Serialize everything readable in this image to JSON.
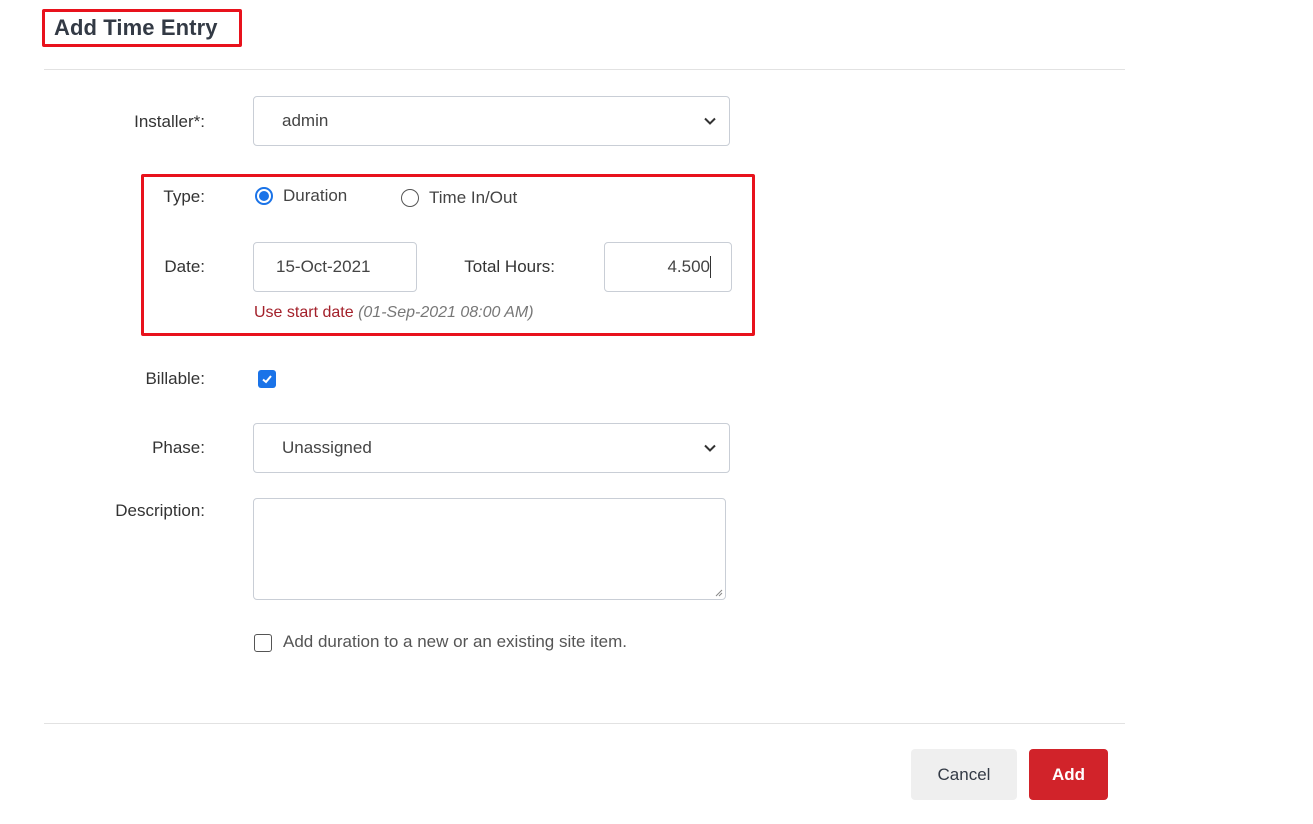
{
  "dialog": {
    "title": "Add Time Entry"
  },
  "form": {
    "installer": {
      "label": "Installer*:",
      "value": "admin"
    },
    "type": {
      "label": "Type:",
      "options": [
        {
          "label": "Duration",
          "checked": true
        },
        {
          "label": "Time In/Out",
          "checked": false
        }
      ]
    },
    "date": {
      "label": "Date:",
      "value": "15-Oct-2021"
    },
    "total_hours": {
      "label": "Total Hours:",
      "value": "4.500"
    },
    "start_date_hint": {
      "link": "Use start date",
      "date": "(01-Sep-2021 08:00 AM)"
    },
    "billable": {
      "label": "Billable:",
      "checked": true
    },
    "phase": {
      "label": "Phase:",
      "value": "Unassigned"
    },
    "description": {
      "label": "Description:",
      "value": ""
    },
    "add_duration": {
      "label": "Add duration to a new or an existing site item.",
      "checked": false
    }
  },
  "actions": {
    "cancel_label": "Cancel",
    "add_label": "Add"
  },
  "colors": {
    "accent_blue": "#1a73e8",
    "primary_red": "#d1232a",
    "highlight_red": "#e8121c",
    "hint_red": "#a3202a"
  }
}
